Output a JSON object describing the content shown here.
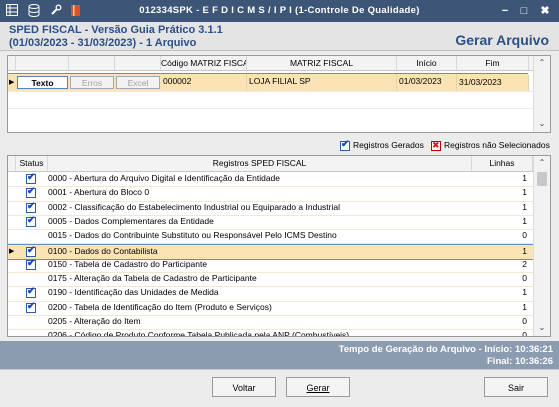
{
  "titlebar": {
    "title": "012334SPK - E F D  I C M S / I P I (1-Controle De Qualidade)",
    "minimize": "−",
    "maximize": "□",
    "close": "✖"
  },
  "header": {
    "line1": "SPED FISCAL - Versão Guia Prático 3.1.1",
    "line2": "(01/03/2023 - 31/03/2023) - 1 Arquivo",
    "action_title": "Gerar Arquivo"
  },
  "files_grid": {
    "columns": [
      "Código MATRIZ FISCAL",
      "MATRIZ FISCAL",
      "Início",
      "Fim"
    ],
    "buttons": {
      "texto": "Texto",
      "erros": "Erros",
      "excel": "Excel"
    },
    "row": {
      "codigo": "000002",
      "matriz": "LOJA FILIAL SP",
      "inicio": "01/03/2023",
      "fim": "31/03/2023"
    }
  },
  "legend": {
    "gerados": "Registros Gerados",
    "nao_selecionados": "Registros não Selecionados"
  },
  "records_grid": {
    "columns": {
      "status": "Status",
      "registros": "Registros SPED FISCAL",
      "linhas": "Linhas"
    },
    "rows": [
      {
        "checked": true,
        "desc": "0000 - Abertura do Arquivo Digital e Identificação da Entidade",
        "linhas": "1"
      },
      {
        "checked": true,
        "desc": "0001 - Abertura do Bloco 0",
        "linhas": "1"
      },
      {
        "checked": true,
        "desc": "0002 - Classificação do Estabelecimento Industrial ou Equiparado a Industrial",
        "linhas": "1"
      },
      {
        "checked": true,
        "desc": "0005 - Dados Complementares da Entidade",
        "linhas": "1"
      },
      {
        "checked": false,
        "desc": "0015 - Dados do Contribuinte Substituto ou Responsável Pelo ICMS Destino",
        "linhas": "0"
      },
      {
        "checked": true,
        "desc": "0100 - Dados do Contabilista",
        "linhas": "1",
        "selected": true
      },
      {
        "checked": true,
        "desc": "0150 - Tabela de Cadastro do Participante",
        "linhas": "2"
      },
      {
        "checked": false,
        "desc": "0175 - Alteração da Tabela de Cadastro de Participante",
        "linhas": "0"
      },
      {
        "checked": true,
        "desc": "0190 - Identificação das Unidades de Medida",
        "linhas": "1"
      },
      {
        "checked": true,
        "desc": "0200 - Tabela de Identificação do Item (Produto e Serviços)",
        "linhas": "1"
      },
      {
        "checked": false,
        "desc": "0205 - Alteração do Item",
        "linhas": "0"
      },
      {
        "checked": false,
        "desc": "0206 - Código de Produto Conforme Tabela Publicada pela ANP (Combustíveis)",
        "linhas": "0"
      }
    ]
  },
  "status": {
    "line1": "Tempo de Geração do Arquivo - Início: 10:36:21",
    "line2": "Final: 10:36:26"
  },
  "buttons": {
    "voltar": "Voltar",
    "gerar": "Gerar",
    "sair": "Sair"
  }
}
